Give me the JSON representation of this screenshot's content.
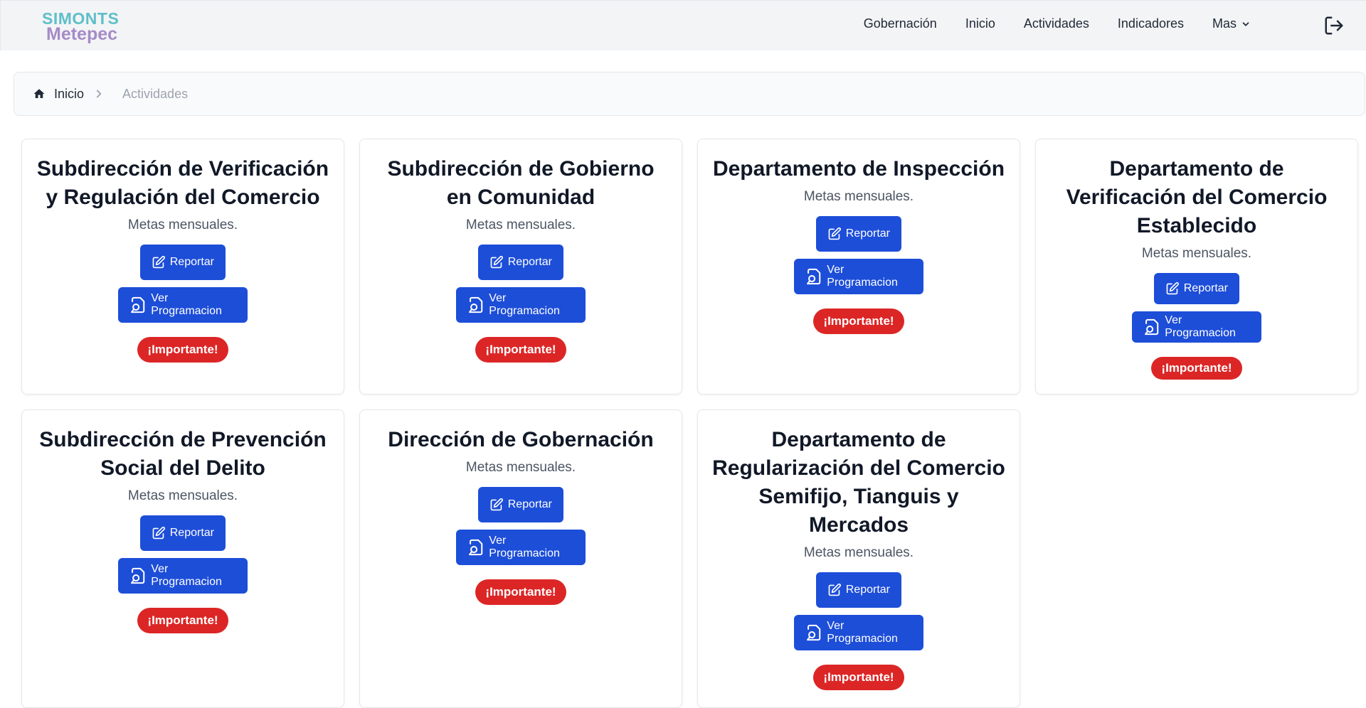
{
  "logo": {
    "line1": "SIMONTS",
    "line2": "Metepec"
  },
  "nav": {
    "links": [
      "Gobernación",
      "Inicio",
      "Actividades",
      "Indicadores"
    ],
    "more": "Mas"
  },
  "breadcrumb": {
    "home": "Inicio",
    "current": "Actividades"
  },
  "cards": [
    {
      "title": "Subdirección de Verificación y Regulación del Comercio",
      "subtitle": "Metas mensuales.",
      "report": "Reportar",
      "program": "Ver Programacion",
      "badge": "¡Importante!"
    },
    {
      "title": "Subdirección de Gobierno en Comunidad",
      "subtitle": "Metas mensuales.",
      "report": "Reportar",
      "program": "Ver Programacion",
      "badge": "¡Importante!"
    },
    {
      "title": "Departamento de Inspección",
      "subtitle": "Metas mensuales.",
      "report": "Reportar",
      "program": "Ver Programacion",
      "badge": "¡Importante!"
    },
    {
      "title": "Departamento de Verificación del Comercio Establecido",
      "subtitle": "Metas mensuales.",
      "report": "Reportar",
      "program": "Ver Programacion",
      "badge": "¡Importante!"
    },
    {
      "title": "Subdirección de Prevención Social del Delito",
      "subtitle": "Metas mensuales.",
      "report": "Reportar",
      "program": "Ver Programacion",
      "badge": "¡Importante!"
    },
    {
      "title": "Dirección de Gobernación",
      "subtitle": "Metas mensuales.",
      "report": "Reportar",
      "program": "Ver Programacion",
      "badge": "¡Importante!"
    },
    {
      "title": "Departamento de Regularización del Comercio Semifijo, Tianguis y Mercados",
      "subtitle": "Metas mensuales.",
      "report": "Reportar",
      "program": "Ver Programacion",
      "badge": "¡Importante!"
    }
  ],
  "colors": {
    "primary_button": "#1d4ed8",
    "badge": "#dc2626",
    "logo_top": "#5fbfc9",
    "logo_bottom": "#a68bc7"
  },
  "icons": {
    "report": "edit-icon",
    "program": "file-search-icon",
    "home": "home-icon",
    "separator": "chevron-right-icon",
    "more": "chevron-down-icon",
    "logout": "logout-icon"
  }
}
